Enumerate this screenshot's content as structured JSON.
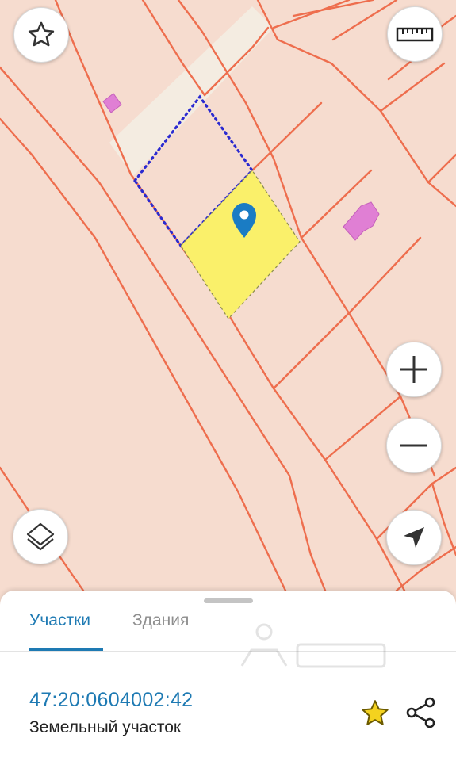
{
  "map": {
    "background_color": "#f6dccf",
    "line_color": "#ee6e4e",
    "selected_parcel_color": "#faf06a",
    "building_color": "#e07fd4",
    "road_color": "#f4ece1",
    "marker_color": "#1a7cc4"
  },
  "controls": {
    "favorite_icon": "star-outline-icon",
    "ruler_icon": "ruler-icon",
    "zoom_in_icon": "plus-icon",
    "zoom_out_icon": "minus-icon",
    "layers_icon": "layers-icon",
    "location_icon": "navigation-arrow-icon"
  },
  "panel": {
    "tabs": [
      {
        "label": "Участки",
        "active": true
      },
      {
        "label": "Здания",
        "active": false
      }
    ],
    "parcel": {
      "number": "47:20:0604002:42",
      "type": "Земельный участок"
    },
    "accent_color": "#1e7ab3",
    "star_color": "#f4d21f"
  }
}
